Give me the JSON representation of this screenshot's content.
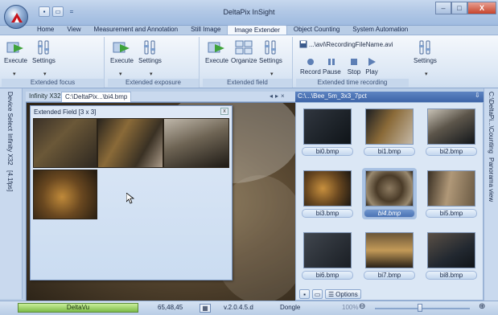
{
  "window": {
    "title": "DeltaPix InSight"
  },
  "tabs": [
    "Home",
    "View",
    "Measurement and Annotation",
    "Still Image",
    "Image Extender",
    "Object Counting",
    "System Automation"
  ],
  "active_tab_index": 4,
  "ribbon": {
    "extended_focus": {
      "execute": "Execute",
      "settings": "Settings",
      "label": "Extended focus"
    },
    "extended_exposure": {
      "execute": "Execute",
      "settings": "Settings",
      "label": "Extended exposure"
    },
    "extended_field": {
      "execute": "Execute",
      "organize": "Organize",
      "settings": "Settings",
      "label": "Extended field"
    },
    "time_recording": {
      "file": "...\\avi\\RecordingFileName.avi",
      "record": "Record",
      "pause": "Pause",
      "stop": "Stop",
      "play": "Play",
      "settings": "Settings",
      "label": "Extended time recording"
    }
  },
  "left_strip": {
    "device_select": "Device Select",
    "camera": "Infinity X32",
    "status": "[4.1fps]"
  },
  "doc_tabs": {
    "tab1": "Infinity X32",
    "tab2": "C:\\DeltaPix...\\bi4.bmp"
  },
  "float_window": {
    "title": "Extended Field [3 x 3]",
    "close": "x"
  },
  "right_panel": {
    "header": "C:\\...\\Bee_5m_3x3_7pct",
    "pin": "⇩",
    "thumbnails": [
      "bi0.bmp",
      "bi1.bmp",
      "bi2.bmp",
      "bi3.bmp",
      "bi4.bmp",
      "bi5.bmp",
      "bi6.bmp",
      "bi7.bmp",
      "bi8.bmp"
    ],
    "selected_index": 4,
    "options": "Options"
  },
  "right_strip": {
    "tab1": "C:\\DeltaPi...\\Counting",
    "tab2": "Panorama view"
  },
  "status": {
    "progress_label": "DeltaVu",
    "progress": 1.0,
    "color_value": "65,48,45",
    "version": "v.2.0.4.5.d",
    "dongle": "Dongle",
    "zoom": "100%",
    "zoom_minus": "⊖",
    "zoom_plus": "⊕"
  }
}
